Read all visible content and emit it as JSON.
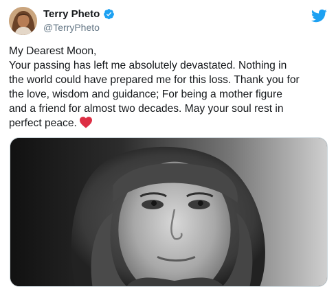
{
  "author": {
    "display_name": "Terry Pheto",
    "handle": "@TerryPheto",
    "verified": true
  },
  "tweet": {
    "lines": [
      "My Dearest Moon,",
      "Your passing has left me absolutely devastated. Nothing in",
      "the world could have prepared me for this loss. Thank you for",
      "the love, wisdom and guidance; For being a mother figure",
      "and a friend for almost two decades. May your soul rest in",
      "perfect peace."
    ],
    "emoji": "red-heart-icon"
  },
  "icons": {
    "verified": "verified-badge-icon",
    "brand": "twitter-bird-icon"
  },
  "colors": {
    "twitter_blue": "#1da1f2",
    "heart_red": "#e0245e",
    "text": "#14171a",
    "muted": "#657786"
  }
}
